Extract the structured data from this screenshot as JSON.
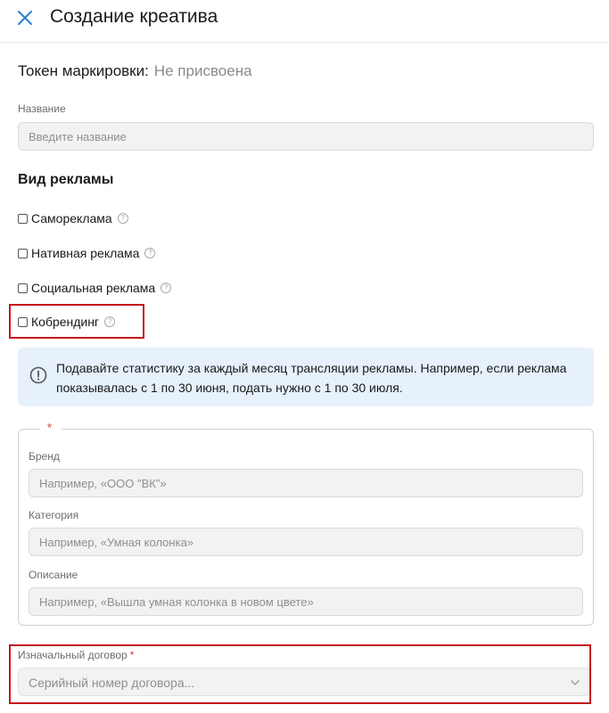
{
  "header": {
    "title": "Создание креатива",
    "close_icon": "close-icon"
  },
  "token": {
    "label": "Токен маркировки:",
    "value": "Не присвоена"
  },
  "name_field": {
    "label": "Название",
    "placeholder": "Введите название"
  },
  "ad_type": {
    "title": "Вид рекламы",
    "options": [
      {
        "label": "Самореклама",
        "checked": false
      },
      {
        "label": "Нативная реклама",
        "checked": false
      },
      {
        "label": "Социальная реклама",
        "checked": false
      },
      {
        "label": "Кобрендинг",
        "checked": false
      }
    ]
  },
  "info_banner": {
    "icon": "info-icon",
    "text": "Подавайте статистику за каждый месяц трансляции рекламы. Например, если реклама показывалась с 1 по 30 июня, подать нужно с 1 по 30 июля."
  },
  "cobranding_group": {
    "required_mark": "*",
    "brand": {
      "label": "Бренд",
      "placeholder": "Например, «ООО \"ВК\"»"
    },
    "category": {
      "label": "Категория",
      "placeholder": "Например, «Умная колонка»"
    },
    "description": {
      "label": "Описание",
      "placeholder": "Например, «Вышла умная колонка в новом цвете»"
    }
  },
  "contract": {
    "label": "Изначальный договор",
    "required_mark": "*",
    "placeholder": "Серийный номер договора..."
  },
  "colors": {
    "highlight": "#c4161c",
    "banner_bg": "#e6f1fb",
    "accent": "#2b7fd0"
  }
}
